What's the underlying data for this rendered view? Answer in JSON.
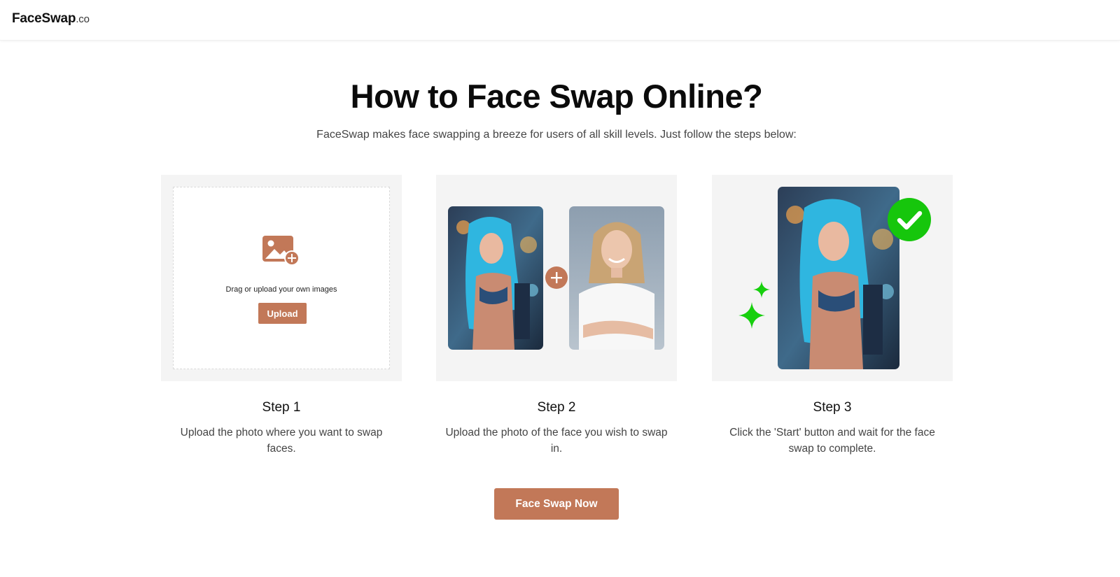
{
  "header": {
    "logo_main": "FaceSwap",
    "logo_tld": ".co"
  },
  "hero": {
    "title": "How to Face Swap Online?",
    "subtitle": "FaceSwap makes face swapping a breeze for users of all skill levels. Just follow the steps below:"
  },
  "steps": [
    {
      "title": "Step 1",
      "description": "Upload the photo where you want to swap faces.",
      "drop_text": "Drag or upload your own images",
      "upload_label": "Upload"
    },
    {
      "title": "Step 2",
      "description": "Upload the photo of the face you wish to swap in."
    },
    {
      "title": "Step 3",
      "description": "Click the 'Start' button and wait for the face swap to complete."
    }
  ],
  "cta": {
    "label": "Face Swap Now"
  },
  "icons": {
    "upload": "image-add-icon",
    "plus": "plus-icon",
    "check": "check-icon",
    "sparkle": "sparkle-icon"
  },
  "colors": {
    "accent": "#c27858",
    "success": "#16c60c",
    "card_bg": "#f4f4f4"
  }
}
